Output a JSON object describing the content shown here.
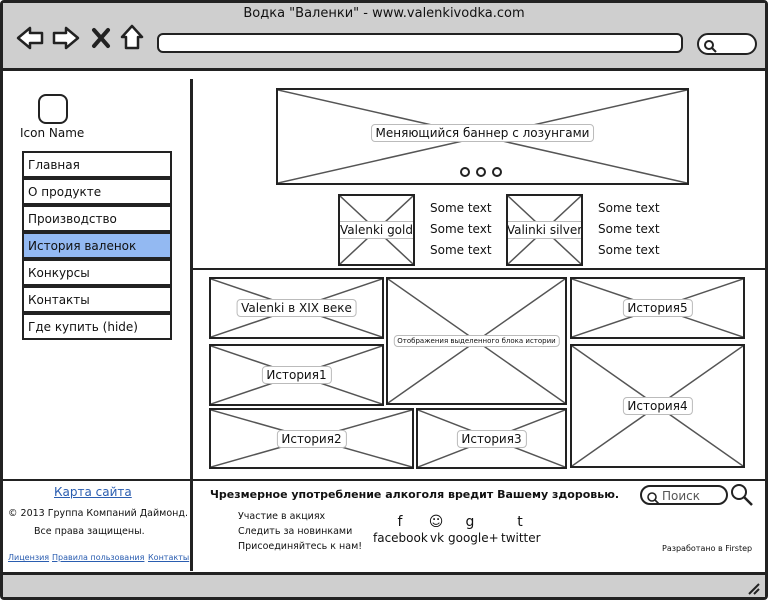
{
  "window": {
    "title": "Водка \"Валенки\" - www.valenkivodka.com"
  },
  "sidebar": {
    "icon_label": "Icon Name",
    "items": [
      {
        "label": "Главная"
      },
      {
        "label": "О продукте"
      },
      {
        "label": "Производство"
      },
      {
        "label": "История валенок",
        "active": true
      },
      {
        "label": "Конкурсы"
      },
      {
        "label": "Контакты"
      },
      {
        "label": "Где купить (hide)"
      }
    ]
  },
  "banner": {
    "label": "Меняющийся баннер с лозунгами",
    "dots": 3
  },
  "products": [
    {
      "label": "Valenki gold",
      "texts": [
        "Some text",
        "Some text",
        "Some text"
      ]
    },
    {
      "label": "Valinki silver",
      "texts": [
        "Some text",
        "Some text",
        "Some text"
      ]
    }
  ],
  "history": {
    "xix": "Valenki в XIX веке",
    "display": "Отображения выделенного блока истории",
    "h1": "История1",
    "h2": "История2",
    "h3": "История3",
    "h4": "История4",
    "h5": "История5"
  },
  "footer": {
    "sitemap": "Карта сайта",
    "copyright": "© 2013 Группа Компаний Даймонд.",
    "rights": "Все права защищены.",
    "links": [
      "Лицензия",
      "Правила пользования",
      "Контакты"
    ],
    "warning": "Чрезмерное употребление алкоголя вредит  Вашему здоровью.",
    "search_placeholder": "Поиск",
    "actions": [
      "Участие в акциях",
      "Следить за новинками",
      "Присоединяйтесь к нам!"
    ],
    "social": [
      {
        "label": "facebook",
        "glyph": "f"
      },
      {
        "label": "vk",
        "glyph": "☺"
      },
      {
        "label": "google+",
        "glyph": "g"
      },
      {
        "label": "twitter",
        "glyph": "t"
      }
    ],
    "developer": "Разработано в Firstep"
  }
}
